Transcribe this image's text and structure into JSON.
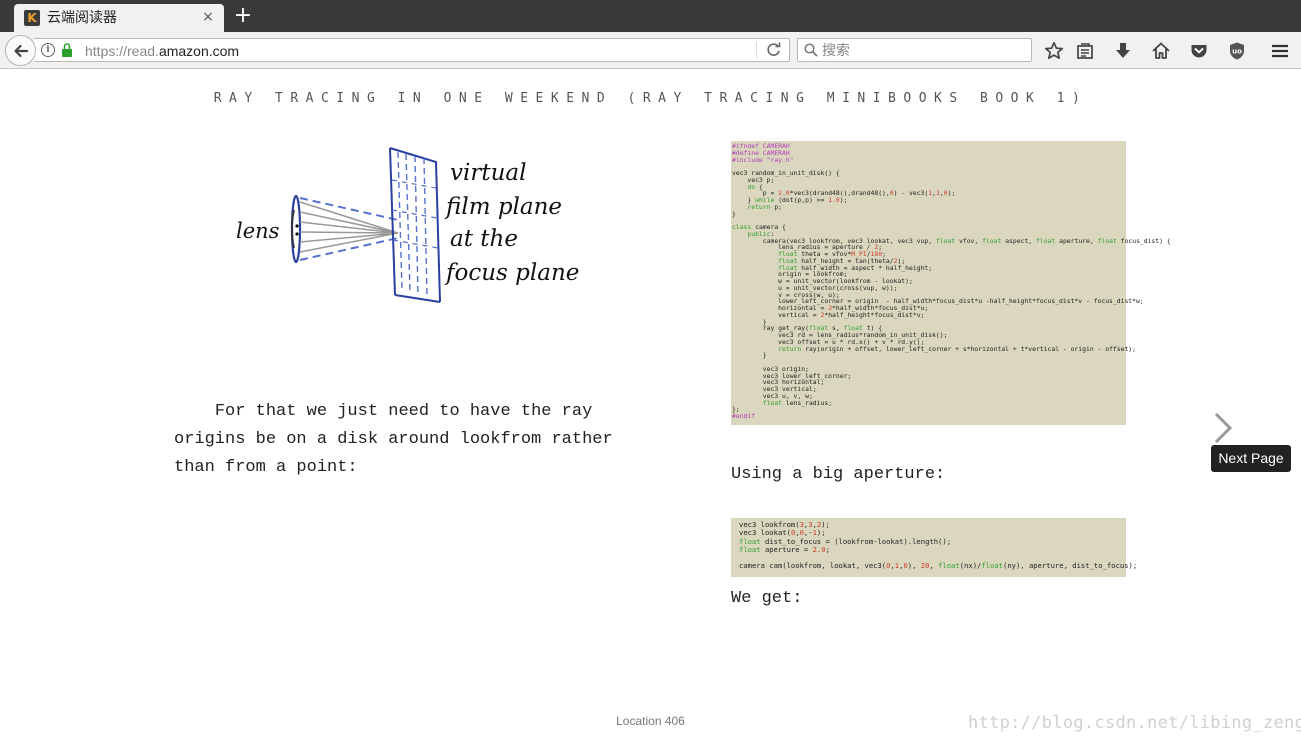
{
  "browser": {
    "tab": {
      "title": "云端阅读器",
      "favicon": "K",
      "close": "×"
    },
    "new_tab": "+",
    "url": {
      "prefix": "https://read.",
      "domain": "amazon.com"
    },
    "search_placeholder": "搜索"
  },
  "book": {
    "title": "RAY TRACING IN ONE WEEKEND (RAY TRACING MINIBOOKS BOOK 1)",
    "sketch": {
      "lens_label": "lens",
      "plane_label_lines": [
        "virtual",
        "film plane",
        "at the",
        "focus plane"
      ]
    },
    "left_paragraph": "    For that we just need to have the ray origins be on a disk around lookfrom rather than from a point:",
    "code_camera": [
      [
        [
          "#ifndef CAMERAH",
          "pre"
        ]
      ],
      [
        [
          "#define CAMERAH",
          "pre"
        ]
      ],
      [
        [
          "#include \"ray.h\"",
          "pre"
        ]
      ],
      [],
      [
        [
          "vec3 random_in_unit_disk() {",
          ""
        ]
      ],
      [
        [
          "    vec3 p;",
          ""
        ]
      ],
      [
        [
          "    ",
          ""
        ],
        [
          "do",
          "kw"
        ],
        [
          " {",
          ""
        ]
      ],
      [
        [
          "        p = ",
          ""
        ],
        [
          "2.0",
          "num"
        ],
        [
          "*vec3(drand48(),drand48(),",
          ""
        ],
        [
          "0",
          "num"
        ],
        [
          ") - vec3(",
          ""
        ],
        [
          "1",
          "num"
        ],
        [
          ",",
          ""
        ],
        [
          "1",
          "num"
        ],
        [
          ",",
          ""
        ],
        [
          "0",
          "num"
        ],
        [
          ");",
          ""
        ]
      ],
      [
        [
          "    } ",
          ""
        ],
        [
          "while",
          "kw"
        ],
        [
          " (dot(p,p) >= ",
          ""
        ],
        [
          "1.0",
          "num"
        ],
        [
          ");",
          ""
        ]
      ],
      [
        [
          "    ",
          ""
        ],
        [
          "return",
          "kw"
        ],
        [
          " p;",
          ""
        ]
      ],
      [
        [
          "}",
          ""
        ]
      ],
      [],
      [
        [
          "class",
          "kw"
        ],
        [
          " camera {",
          ""
        ]
      ],
      [
        [
          "    ",
          ""
        ],
        [
          "public",
          "kw"
        ],
        [
          ":",
          ""
        ]
      ],
      [
        [
          "        camera(vec3 lookfrom, vec3 lookat, vec3 vup, ",
          ""
        ],
        [
          "float",
          "kw"
        ],
        [
          " vfov, ",
          ""
        ],
        [
          "float",
          "kw"
        ],
        [
          " aspect, ",
          ""
        ],
        [
          "float",
          "kw"
        ],
        [
          " aperture, ",
          ""
        ],
        [
          "float",
          "kw"
        ],
        [
          " focus_dist) {",
          ""
        ]
      ],
      [
        [
          "            lens_radius = aperture / ",
          ""
        ],
        [
          "2",
          "num"
        ],
        [
          ";",
          ""
        ]
      ],
      [
        [
          "            ",
          ""
        ],
        [
          "float",
          "kw"
        ],
        [
          " theta = vfov*",
          ""
        ],
        [
          "M_PI",
          "num"
        ],
        [
          "/",
          ""
        ],
        [
          "180",
          "num"
        ],
        [
          ";",
          ""
        ]
      ],
      [
        [
          "            ",
          ""
        ],
        [
          "float",
          "kw"
        ],
        [
          " half_height = tan(theta/",
          ""
        ],
        [
          "2",
          "num"
        ],
        [
          ");",
          ""
        ]
      ],
      [
        [
          "            ",
          ""
        ],
        [
          "float",
          "kw"
        ],
        [
          " half_width = aspect * half_height;",
          ""
        ]
      ],
      [
        [
          "            origin = lookfrom;",
          ""
        ]
      ],
      [
        [
          "            w = unit_vector(lookfrom - lookat);",
          ""
        ]
      ],
      [
        [
          "            u = unit_vector(cross(vup, w));",
          ""
        ]
      ],
      [
        [
          "            v = cross(w, u);",
          ""
        ]
      ],
      [
        [
          "            lower_left_corner = origin  - half_width*focus_dist*u -half_height*focus_dist*v - focus_dist*w;",
          ""
        ]
      ],
      [
        [
          "            horizontal = ",
          ""
        ],
        [
          "2",
          "num"
        ],
        [
          "*half_width*focus_dist*u;",
          ""
        ]
      ],
      [
        [
          "            vertical = ",
          ""
        ],
        [
          "2",
          "num"
        ],
        [
          "*half_height*focus_dist*v;",
          ""
        ]
      ],
      [
        [
          "        }",
          ""
        ]
      ],
      [
        [
          "        ray get_ray(",
          ""
        ],
        [
          "float",
          "kw"
        ],
        [
          " s, ",
          ""
        ],
        [
          "float",
          "kw"
        ],
        [
          " t) {",
          ""
        ]
      ],
      [
        [
          "            vec3 rd = lens_radius*random_in_unit_disk();",
          ""
        ]
      ],
      [
        [
          "            vec3 offset = u * rd.x() + v * rd.y();",
          ""
        ]
      ],
      [
        [
          "            ",
          ""
        ],
        [
          "return",
          "kw"
        ],
        [
          " ray(origin + offset, lower_left_corner + s*horizontal + t*vertical - origin - offset);",
          ""
        ]
      ],
      [
        [
          "        }",
          ""
        ]
      ],
      [],
      [
        [
          "        vec3 origin;",
          ""
        ]
      ],
      [
        [
          "        vec3 lower_left_corner;",
          ""
        ]
      ],
      [
        [
          "        vec3 horizontal;",
          ""
        ]
      ],
      [
        [
          "        vec3 vertical;",
          ""
        ]
      ],
      [
        [
          "        vec3 u, v, w;",
          ""
        ]
      ],
      [
        [
          "        ",
          ""
        ],
        [
          "float",
          "kw"
        ],
        [
          " lens_radius;",
          ""
        ]
      ],
      [
        [
          "};",
          ""
        ]
      ],
      [
        [
          "#endif",
          "pre"
        ]
      ]
    ],
    "aperture_label": "Using a big aperture:",
    "code_aperture": [
      [
        [
          "vec3 lookfrom(",
          ""
        ],
        [
          "3",
          "num"
        ],
        [
          ",",
          ""
        ],
        [
          "3",
          "num"
        ],
        [
          ",",
          ""
        ],
        [
          "2",
          "num"
        ],
        [
          ");",
          ""
        ]
      ],
      [
        [
          "vec3 lookat(",
          ""
        ],
        [
          "0",
          "num"
        ],
        [
          ",",
          ""
        ],
        [
          "0",
          "num"
        ],
        [
          ",-",
          ""
        ],
        [
          "1",
          "num"
        ],
        [
          ");",
          ""
        ]
      ],
      [
        [
          "float",
          "kw"
        ],
        [
          " dist_to_focus = (lookfrom-lookat).length();",
          ""
        ]
      ],
      [
        [
          "float",
          "kw"
        ],
        [
          " aperture = ",
          ""
        ],
        [
          "2.0",
          "num"
        ],
        [
          ";",
          ""
        ]
      ],
      [],
      [
        [
          "camera cam(lookfrom, lookat, vec3(",
          ""
        ],
        [
          "0",
          "num"
        ],
        [
          ",",
          ""
        ],
        [
          "1",
          "num"
        ],
        [
          ",",
          ""
        ],
        [
          "0",
          "num"
        ],
        [
          "), ",
          ""
        ],
        [
          "20",
          "num"
        ],
        [
          ", ",
          ""
        ],
        [
          "float",
          "kw"
        ],
        [
          "(nx)/",
          ""
        ],
        [
          "float",
          "kw"
        ],
        [
          "(ny), aperture, dist_to_focus);",
          ""
        ]
      ]
    ],
    "we_get_label": "We get:",
    "next_page_tooltip": "Next Page",
    "location": "Location 406"
  },
  "watermark": "http://blog.csdn.net/libing_zeng"
}
